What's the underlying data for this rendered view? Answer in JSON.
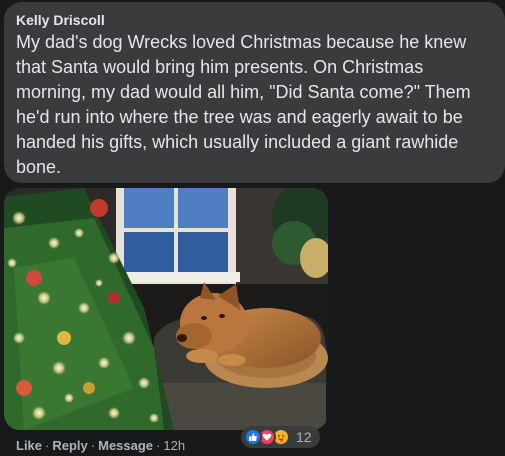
{
  "comment": {
    "author": "Kelly Driscoll",
    "text": "My dad's dog Wrecks loved Christmas because he knew that Santa would bring him presents. On Christmas morning, my dad would all him, \"Did Santa come?\" Them he'd run into where the tree was and eagerly await to be handed his gifts, which usually included a giant rawhide bone."
  },
  "actions": {
    "like_label": "Like",
    "reply_label": "Reply",
    "message_label": "Message",
    "separator": "·",
    "timestamp": "12h"
  },
  "reactions": {
    "icons": [
      "like-icon",
      "love-icon",
      "care-icon"
    ],
    "count": "12"
  },
  "colors": {
    "background": "#18191a",
    "bubble": "#3a3b3c",
    "text": "#e4e6eb",
    "secondary_text": "#b0b3b8",
    "like_blue": "#1877f2",
    "love_red": "#f33e58",
    "care_yellow": "#f7b125"
  }
}
